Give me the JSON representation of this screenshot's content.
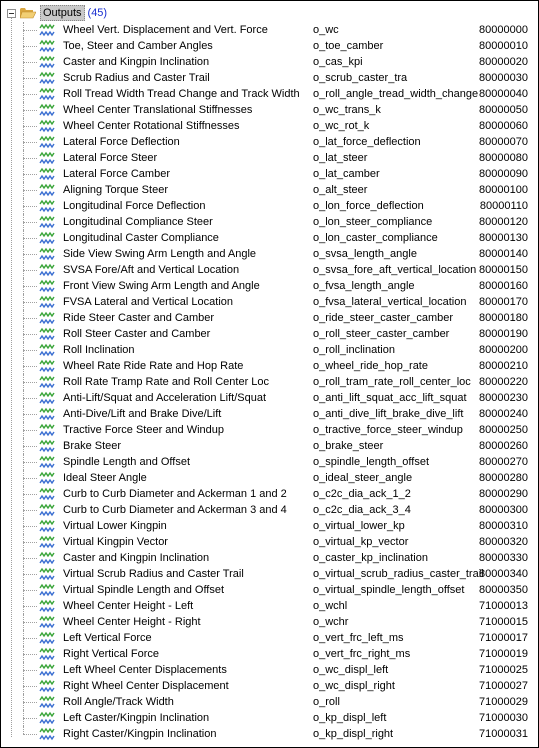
{
  "tree": {
    "root_label": "Outputs",
    "root_count": "(45)",
    "count_color": "#1a2fd0",
    "items": [
      {
        "name": "Wheel Vert. Displacement and Vert. Force",
        "var": "o_wc",
        "code": "80000000"
      },
      {
        "name": "Toe, Steer and Camber Angles",
        "var": "o_toe_camber",
        "code": "80000010"
      },
      {
        "name": "Caster and Kingpin Inclination",
        "var": "o_cas_kpi",
        "code": "80000020"
      },
      {
        "name": "Scrub Radius and Caster Trail",
        "var": "o_scrub_caster_tra",
        "code": "80000030"
      },
      {
        "name": "Roll Tread Width Tread Change and Track Width",
        "var": "o_roll_angle_tread_width_change",
        "code": "80000040"
      },
      {
        "name": "Wheel Center Translational Stiffnesses",
        "var": "o_wc_trans_k",
        "code": "80000050"
      },
      {
        "name": "Wheel Center Rotational Stiffnesses",
        "var": "o_wc_rot_k",
        "code": "80000060"
      },
      {
        "name": "Lateral Force Deflection",
        "var": "o_lat_force_deflection",
        "code": "80000070"
      },
      {
        "name": "Lateral Force Steer",
        "var": "o_lat_steer",
        "code": "80000080"
      },
      {
        "name": "Lateral Force Camber",
        "var": "o_lat_camber",
        "code": "80000090"
      },
      {
        "name": "Aligning Torque Steer",
        "var": "o_alt_steer",
        "code": "80000100"
      },
      {
        "name": "Longitudinal Force Deflection",
        "var": "o_lon_force_deflection",
        "code": "80000110"
      },
      {
        "name": "Longitudinal Compliance Steer",
        "var": "o_lon_steer_compliance",
        "code": "80000120"
      },
      {
        "name": "Longitudinal Caster Compliance",
        "var": "o_lon_caster_compliance",
        "code": "80000130"
      },
      {
        "name": "Side View Swing Arm Length and Angle",
        "var": "o_svsa_length_angle",
        "code": "80000140"
      },
      {
        "name": "SVSA Fore/Aft and Vertical Location",
        "var": "o_svsa_fore_aft_vertical_location",
        "code": "80000150"
      },
      {
        "name": "Front View Swing Arm Length and Angle",
        "var": "o_fvsa_length_angle",
        "code": "80000160"
      },
      {
        "name": "FVSA Lateral and Vertical Location",
        "var": "o_fvsa_lateral_vertical_location",
        "code": "80000170"
      },
      {
        "name": "Ride Steer Caster and Camber",
        "var": "o_ride_steer_caster_camber",
        "code": "80000180"
      },
      {
        "name": "Roll Steer Caster and Camber",
        "var": "o_roll_steer_caster_camber",
        "code": "80000190"
      },
      {
        "name": "Roll Inclination",
        "var": "o_roll_inclination",
        "code": "80000200"
      },
      {
        "name": "Wheel Rate Ride Rate and Hop Rate",
        "var": "o_wheel_ride_hop_rate",
        "code": "80000210"
      },
      {
        "name": "Roll Rate Tramp Rate and Roll Center Loc",
        "var": "o_roll_tram_rate_roll_center_loc",
        "code": "80000220"
      },
      {
        "name": "Anti-Lift/Squat and Acceleration Lift/Squat",
        "var": "o_anti_lift_squat_acc_lift_squat",
        "code": "80000230"
      },
      {
        "name": "Anti-Dive/Lift and Brake Dive/Lift",
        "var": "o_anti_dive_lift_brake_dive_lift",
        "code": "80000240"
      },
      {
        "name": "Tractive Force Steer and Windup",
        "var": "o_tractive_force_steer_windup",
        "code": "80000250"
      },
      {
        "name": "Brake Steer",
        "var": "o_brake_steer",
        "code": "80000260"
      },
      {
        "name": "Spindle Length and Offset",
        "var": "o_spindle_length_offset",
        "code": "80000270"
      },
      {
        "name": "Ideal Steer Angle",
        "var": "o_ideal_steer_angle",
        "code": "80000280"
      },
      {
        "name": "Curb to Curb Diameter and Ackerman 1 and 2",
        "var": "o_c2c_dia_ack_1_2",
        "code": "80000290"
      },
      {
        "name": "Curb to Curb Diameter and Ackerman 3 and 4",
        "var": "o_c2c_dia_ack_3_4",
        "code": "80000300"
      },
      {
        "name": "Virtual Lower Kingpin",
        "var": "o_virtual_lower_kp",
        "code": "80000310"
      },
      {
        "name": "Virtual Kingpin Vector",
        "var": "o_virtual_kp_vector",
        "code": "80000320"
      },
      {
        "name": "Caster and Kingpin Inclination",
        "var": "o_caster_kp_inclination",
        "code": "80000330"
      },
      {
        "name": "Virtual Scrub Radius and Caster Trail",
        "var": "o_virtual_scrub_radius_caster_trail",
        "code": "80000340"
      },
      {
        "name": "Virtual Spindle Length and Offset",
        "var": "o_virtual_spindle_length_offset",
        "code": "80000350"
      },
      {
        "name": "Wheel Center Height - Left",
        "var": "o_wchl",
        "code": "71000013"
      },
      {
        "name": "Wheel Center Height - Right",
        "var": "o_wchr",
        "code": "71000015"
      },
      {
        "name": "Left Vertical Force",
        "var": "o_vert_frc_left_ms",
        "code": "71000017"
      },
      {
        "name": "Right Vertical Force",
        "var": "o_vert_frc_right_ms",
        "code": "71000019"
      },
      {
        "name": "Left Wheel Center Displacements",
        "var": "o_wc_displ_left",
        "code": "71000025"
      },
      {
        "name": "Right Wheel Center Displacement",
        "var": "o_wc_displ_right",
        "code": "71000027"
      },
      {
        "name": "Roll Angle/Track Width",
        "var": "o_roll",
        "code": "71000029"
      },
      {
        "name": "Left Caster/Kingpin Inclination",
        "var": "o_kp_displ_left",
        "code": "71000030"
      },
      {
        "name": "Right Caster/Kingpin Inclination",
        "var": "o_kp_displ_right",
        "code": "71000031"
      }
    ]
  }
}
